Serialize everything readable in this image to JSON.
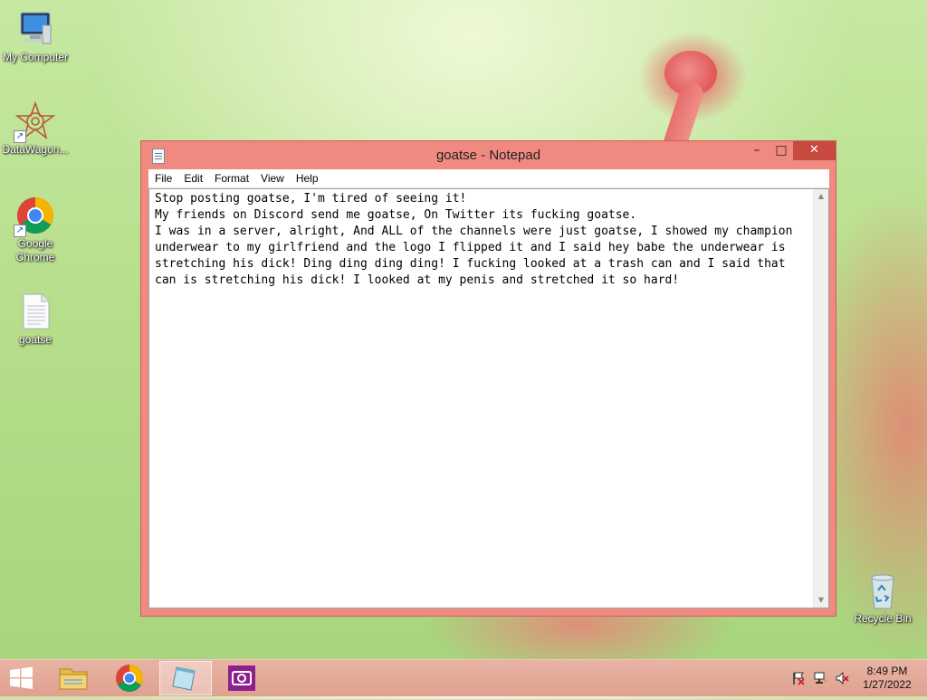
{
  "desktop": {
    "icons": [
      {
        "label": "My Computer"
      },
      {
        "label": "DataWagon..."
      },
      {
        "label": "Google Chrome"
      },
      {
        "label": "goatse"
      },
      {
        "label": "Recycle Bin"
      }
    ]
  },
  "window": {
    "title": "goatse - Notepad",
    "controls": {
      "minimize": "–",
      "maximize": "□",
      "close": "✕"
    },
    "menu": [
      "File",
      "Edit",
      "Format",
      "View",
      "Help"
    ],
    "content": "Stop posting goatse, I'm tired of seeing it!\nMy friends on Discord send me goatse, On Twitter its fucking goatse.\nI was in a server, alright, And ALL of the channels were just goatse, I showed my champion\nunderwear to my girlfriend and the logo I flipped it and I said hey babe the underwear is\nstretching his dick! Ding ding ding ding! I fucking looked at a trash can and I said that\ncan is stretching his dick! I looked at my penis and stretched it so hard!"
  },
  "taskbar": {
    "time": "8:49 PM",
    "date": "1/27/2022",
    "apps": [
      "start-icon",
      "file-explorer-icon",
      "chrome-icon",
      "notepad-icon",
      "camera-app-icon"
    ]
  }
}
